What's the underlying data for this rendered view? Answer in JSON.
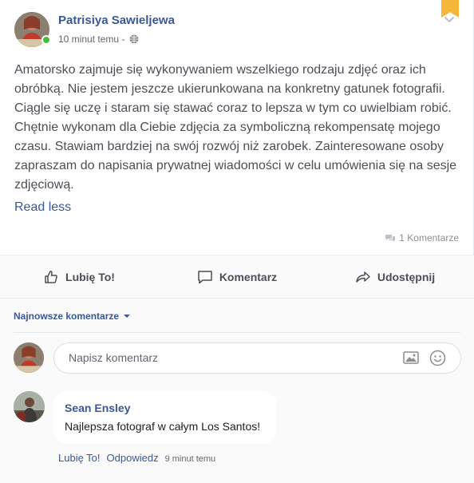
{
  "post": {
    "author": "Patrisiya Sawieljewa",
    "timestamp": "10 minut temu -",
    "privacy_icon": "globe-icon",
    "body": "Amatorsko zajmuje się wykonywaniem wszelkiego rodzaju zdjęć oraz ich obróbką. Nie jestem jeszcze ukierunkowana na konkretny gatunek fotografii. Ciągle się uczę i staram się stawać coraz to lepsza w tym co uwielbiam robić. Chętnie wykonam dla Ciebie zdjęcia za symboliczną rekompensatę mojego czasu. Stawiam bardziej na swój rozwój niż zarobek. Zainteresowane osoby zapraszam do napisania prywatnej wiadomości w celu umówienia się na sesje zdjęciową.",
    "read_less": "Read less",
    "comment_count": "1 Komentarze",
    "online_color": "#45bd3a",
    "bookmark_color": "#f5b73a"
  },
  "actions": {
    "like": "Lubię To!",
    "comment": "Komentarz",
    "share": "Udostępnij"
  },
  "comments": {
    "sort_label": "Najnowsze komentarze",
    "input_placeholder": "Napisz komentarz",
    "items": [
      {
        "author": "Sean Ensley",
        "text": "Najlepsza fotograf w całym Los Santos!",
        "like": "Lubię To!",
        "reply": "Odpowiedz",
        "time": "9 minut temu"
      }
    ]
  },
  "colors": {
    "link": "#385898",
    "text": "#4b4f56"
  }
}
